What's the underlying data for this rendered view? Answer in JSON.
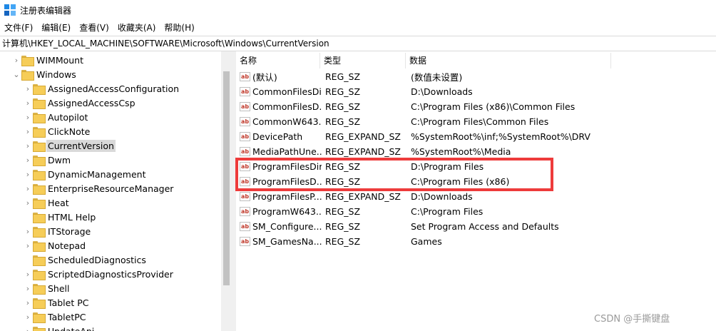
{
  "window": {
    "title": "注册表编辑器",
    "icon_name": "regedit-icon"
  },
  "menu": [
    "文件(F)",
    "编辑(E)",
    "查看(V)",
    "收藏夹(A)",
    "帮助(H)"
  ],
  "address": "计算机\\HKEY_LOCAL_MACHINE\\SOFTWARE\\Microsoft\\Windows\\CurrentVersion",
  "tree": [
    {
      "label": "WIMMount",
      "level": 0,
      "expander": "collapsed"
    },
    {
      "label": "Windows",
      "level": 0,
      "expander": "expanded"
    },
    {
      "label": "AssignedAccessConfiguration",
      "level": 1,
      "expander": "collapsed"
    },
    {
      "label": "AssignedAccessCsp",
      "level": 1,
      "expander": "collapsed"
    },
    {
      "label": "Autopilot",
      "level": 1,
      "expander": "collapsed"
    },
    {
      "label": "ClickNote",
      "level": 1,
      "expander": "collapsed"
    },
    {
      "label": "CurrentVersion",
      "level": 1,
      "expander": "collapsed",
      "selected": true
    },
    {
      "label": "Dwm",
      "level": 1,
      "expander": "collapsed"
    },
    {
      "label": "DynamicManagement",
      "level": 1,
      "expander": "collapsed"
    },
    {
      "label": "EnterpriseResourceManager",
      "level": 1,
      "expander": "collapsed"
    },
    {
      "label": "Heat",
      "level": 1,
      "expander": "collapsed"
    },
    {
      "label": "HTML Help",
      "level": 1,
      "expander": "none"
    },
    {
      "label": "ITStorage",
      "level": 1,
      "expander": "collapsed"
    },
    {
      "label": "Notepad",
      "level": 1,
      "expander": "collapsed"
    },
    {
      "label": "ScheduledDiagnostics",
      "level": 1,
      "expander": "none"
    },
    {
      "label": "ScriptedDiagnosticsProvider",
      "level": 1,
      "expander": "collapsed"
    },
    {
      "label": "Shell",
      "level": 1,
      "expander": "collapsed"
    },
    {
      "label": "Tablet PC",
      "level": 1,
      "expander": "collapsed"
    },
    {
      "label": "TabletPC",
      "level": 1,
      "expander": "collapsed"
    },
    {
      "label": "UpdateApi",
      "level": 1,
      "expander": "collapsed"
    }
  ],
  "columns": [
    "名称",
    "类型",
    "数据"
  ],
  "values": [
    {
      "name": "(默认)",
      "type": "REG_SZ",
      "data": "(数值未设置)"
    },
    {
      "name": "CommonFilesDir",
      "type": "REG_SZ",
      "data": "D:\\Downloads"
    },
    {
      "name": "CommonFilesD...",
      "type": "REG_SZ",
      "data": "C:\\Program Files (x86)\\Common Files"
    },
    {
      "name": "CommonW643...",
      "type": "REG_SZ",
      "data": "C:\\Program Files\\Common Files"
    },
    {
      "name": "DevicePath",
      "type": "REG_EXPAND_SZ",
      "data": "%SystemRoot%\\inf;%SystemRoot%\\DRV"
    },
    {
      "name": "MediaPathUne...",
      "type": "REG_EXPAND_SZ",
      "data": "%SystemRoot%\\Media"
    },
    {
      "name": "ProgramFilesDir",
      "type": "REG_SZ",
      "data": "D:\\Program Files"
    },
    {
      "name": "ProgramFilesD...",
      "type": "REG_SZ",
      "data": "C:\\Program Files (x86)"
    },
    {
      "name": "ProgramFilesP...",
      "type": "REG_EXPAND_SZ",
      "data": "D:\\Downloads"
    },
    {
      "name": "ProgramW643...",
      "type": "REG_SZ",
      "data": "C:\\Program Files"
    },
    {
      "name": "SM_Configure...",
      "type": "REG_SZ",
      "data": "Set Program Access and Defaults"
    },
    {
      "name": "SM_GamesNa...",
      "type": "REG_SZ",
      "data": "Games"
    }
  ],
  "value_icon_text": "ab",
  "highlight_color": "#ee3b3b",
  "selection_color": "#d9d9d9",
  "watermark": "CSDN @手撕键盘"
}
